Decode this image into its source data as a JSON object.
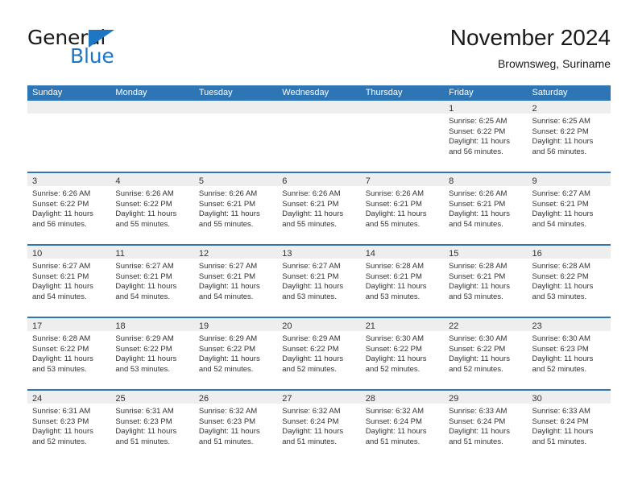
{
  "logo": {
    "word1": "General",
    "word2": "Blue",
    "flag_color": "#1f77c4"
  },
  "header": {
    "title": "November 2024",
    "location": "Brownsweg, Suriname"
  },
  "colors": {
    "header_blue": "#2e75b6",
    "day_band_gray": "#eeeeee",
    "text": "#333333"
  },
  "weekdays": [
    "Sunday",
    "Monday",
    "Tuesday",
    "Wednesday",
    "Thursday",
    "Friday",
    "Saturday"
  ],
  "weeks": [
    [
      {
        "day": "",
        "empty": true
      },
      {
        "day": "",
        "empty": true
      },
      {
        "day": "",
        "empty": true
      },
      {
        "day": "",
        "empty": true
      },
      {
        "day": "",
        "empty": true
      },
      {
        "day": "1",
        "sunrise": "Sunrise: 6:25 AM",
        "sunset": "Sunset: 6:22 PM",
        "daylight": "Daylight: 11 hours and 56 minutes."
      },
      {
        "day": "2",
        "sunrise": "Sunrise: 6:25 AM",
        "sunset": "Sunset: 6:22 PM",
        "daylight": "Daylight: 11 hours and 56 minutes."
      }
    ],
    [
      {
        "day": "3",
        "sunrise": "Sunrise: 6:26 AM",
        "sunset": "Sunset: 6:22 PM",
        "daylight": "Daylight: 11 hours and 56 minutes."
      },
      {
        "day": "4",
        "sunrise": "Sunrise: 6:26 AM",
        "sunset": "Sunset: 6:22 PM",
        "daylight": "Daylight: 11 hours and 55 minutes."
      },
      {
        "day": "5",
        "sunrise": "Sunrise: 6:26 AM",
        "sunset": "Sunset: 6:21 PM",
        "daylight": "Daylight: 11 hours and 55 minutes."
      },
      {
        "day": "6",
        "sunrise": "Sunrise: 6:26 AM",
        "sunset": "Sunset: 6:21 PM",
        "daylight": "Daylight: 11 hours and 55 minutes."
      },
      {
        "day": "7",
        "sunrise": "Sunrise: 6:26 AM",
        "sunset": "Sunset: 6:21 PM",
        "daylight": "Daylight: 11 hours and 55 minutes."
      },
      {
        "day": "8",
        "sunrise": "Sunrise: 6:26 AM",
        "sunset": "Sunset: 6:21 PM",
        "daylight": "Daylight: 11 hours and 54 minutes."
      },
      {
        "day": "9",
        "sunrise": "Sunrise: 6:27 AM",
        "sunset": "Sunset: 6:21 PM",
        "daylight": "Daylight: 11 hours and 54 minutes."
      }
    ],
    [
      {
        "day": "10",
        "sunrise": "Sunrise: 6:27 AM",
        "sunset": "Sunset: 6:21 PM",
        "daylight": "Daylight: 11 hours and 54 minutes."
      },
      {
        "day": "11",
        "sunrise": "Sunrise: 6:27 AM",
        "sunset": "Sunset: 6:21 PM",
        "daylight": "Daylight: 11 hours and 54 minutes."
      },
      {
        "day": "12",
        "sunrise": "Sunrise: 6:27 AM",
        "sunset": "Sunset: 6:21 PM",
        "daylight": "Daylight: 11 hours and 54 minutes."
      },
      {
        "day": "13",
        "sunrise": "Sunrise: 6:27 AM",
        "sunset": "Sunset: 6:21 PM",
        "daylight": "Daylight: 11 hours and 53 minutes."
      },
      {
        "day": "14",
        "sunrise": "Sunrise: 6:28 AM",
        "sunset": "Sunset: 6:21 PM",
        "daylight": "Daylight: 11 hours and 53 minutes."
      },
      {
        "day": "15",
        "sunrise": "Sunrise: 6:28 AM",
        "sunset": "Sunset: 6:21 PM",
        "daylight": "Daylight: 11 hours and 53 minutes."
      },
      {
        "day": "16",
        "sunrise": "Sunrise: 6:28 AM",
        "sunset": "Sunset: 6:22 PM",
        "daylight": "Daylight: 11 hours and 53 minutes."
      }
    ],
    [
      {
        "day": "17",
        "sunrise": "Sunrise: 6:28 AM",
        "sunset": "Sunset: 6:22 PM",
        "daylight": "Daylight: 11 hours and 53 minutes."
      },
      {
        "day": "18",
        "sunrise": "Sunrise: 6:29 AM",
        "sunset": "Sunset: 6:22 PM",
        "daylight": "Daylight: 11 hours and 53 minutes."
      },
      {
        "day": "19",
        "sunrise": "Sunrise: 6:29 AM",
        "sunset": "Sunset: 6:22 PM",
        "daylight": "Daylight: 11 hours and 52 minutes."
      },
      {
        "day": "20",
        "sunrise": "Sunrise: 6:29 AM",
        "sunset": "Sunset: 6:22 PM",
        "daylight": "Daylight: 11 hours and 52 minutes."
      },
      {
        "day": "21",
        "sunrise": "Sunrise: 6:30 AM",
        "sunset": "Sunset: 6:22 PM",
        "daylight": "Daylight: 11 hours and 52 minutes."
      },
      {
        "day": "22",
        "sunrise": "Sunrise: 6:30 AM",
        "sunset": "Sunset: 6:22 PM",
        "daylight": "Daylight: 11 hours and 52 minutes."
      },
      {
        "day": "23",
        "sunrise": "Sunrise: 6:30 AM",
        "sunset": "Sunset: 6:23 PM",
        "daylight": "Daylight: 11 hours and 52 minutes."
      }
    ],
    [
      {
        "day": "24",
        "sunrise": "Sunrise: 6:31 AM",
        "sunset": "Sunset: 6:23 PM",
        "daylight": "Daylight: 11 hours and 52 minutes."
      },
      {
        "day": "25",
        "sunrise": "Sunrise: 6:31 AM",
        "sunset": "Sunset: 6:23 PM",
        "daylight": "Daylight: 11 hours and 51 minutes."
      },
      {
        "day": "26",
        "sunrise": "Sunrise: 6:32 AM",
        "sunset": "Sunset: 6:23 PM",
        "daylight": "Daylight: 11 hours and 51 minutes."
      },
      {
        "day": "27",
        "sunrise": "Sunrise: 6:32 AM",
        "sunset": "Sunset: 6:24 PM",
        "daylight": "Daylight: 11 hours and 51 minutes."
      },
      {
        "day": "28",
        "sunrise": "Sunrise: 6:32 AM",
        "sunset": "Sunset: 6:24 PM",
        "daylight": "Daylight: 11 hours and 51 minutes."
      },
      {
        "day": "29",
        "sunrise": "Sunrise: 6:33 AM",
        "sunset": "Sunset: 6:24 PM",
        "daylight": "Daylight: 11 hours and 51 minutes."
      },
      {
        "day": "30",
        "sunrise": "Sunrise: 6:33 AM",
        "sunset": "Sunset: 6:24 PM",
        "daylight": "Daylight: 11 hours and 51 minutes."
      }
    ]
  ]
}
